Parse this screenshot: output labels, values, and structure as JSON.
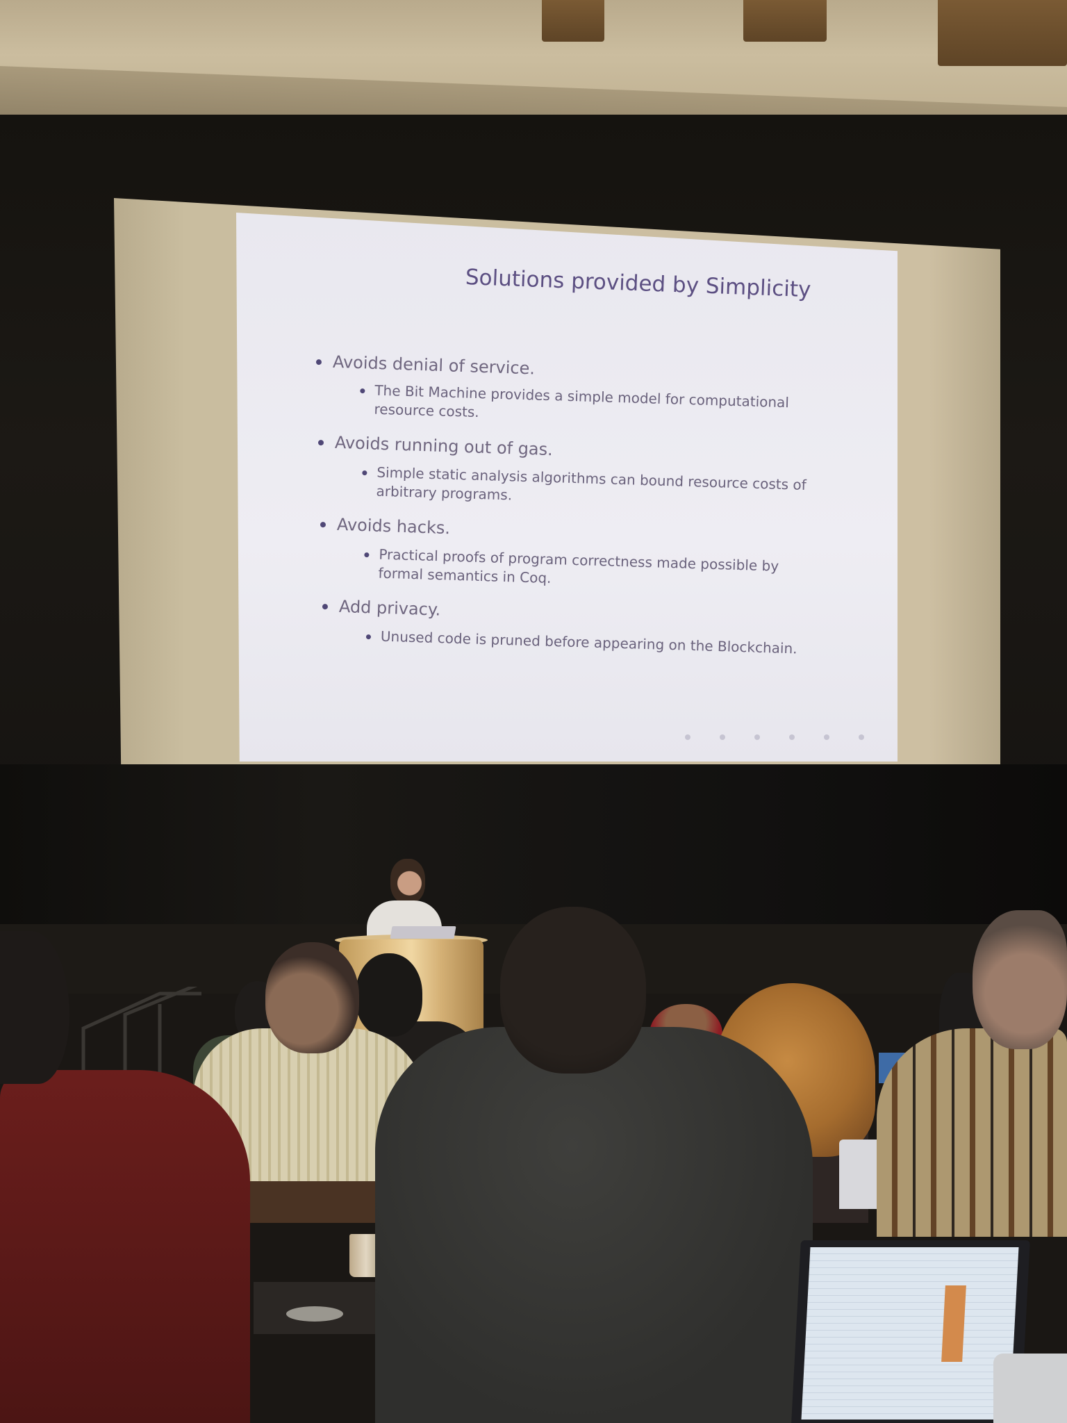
{
  "slide": {
    "title": "Solutions provided by Simplicity",
    "bullets": [
      {
        "text": "Avoids denial of service.",
        "sub": [
          "The Bit Machine provides a simple model for computational",
          "resource costs."
        ]
      },
      {
        "text": "Avoids running out of gas.",
        "sub": [
          "Simple static analysis algorithms can bound resource costs of",
          "arbitrary programs."
        ]
      },
      {
        "text": "Avoids hacks.",
        "sub": [
          "Practical proofs of program correctness made possible by",
          "formal semantics in Coq."
        ]
      },
      {
        "text": "Add privacy.",
        "sub": [
          "Unused code is pruned before appearing on the Blockchain."
        ]
      }
    ]
  },
  "colors": {
    "slide_text": "#4a4270",
    "slide_bg": "#eceaf1",
    "stage_dark": "#15130f"
  }
}
